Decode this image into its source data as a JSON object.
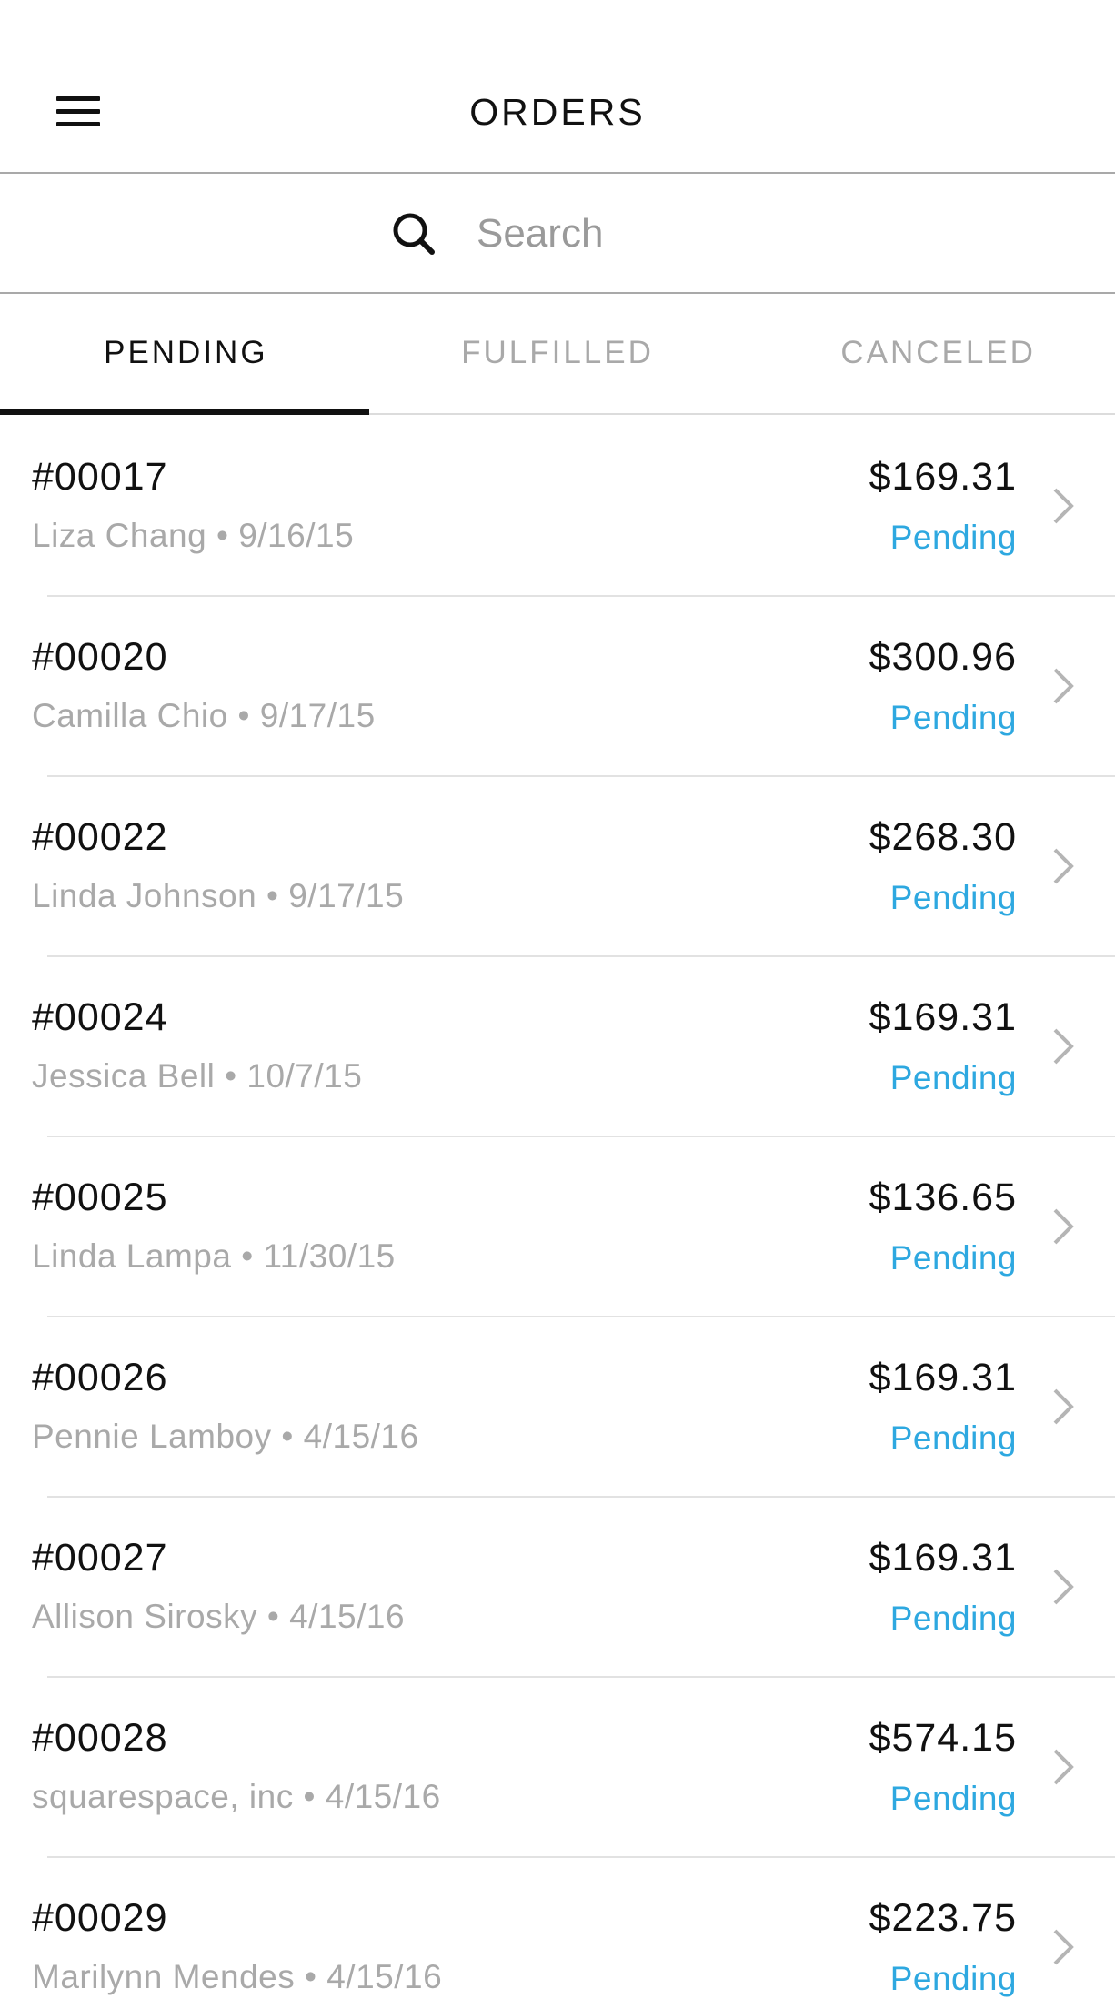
{
  "header": {
    "title": "ORDERS",
    "menu_icon": "hamburger-menu-icon"
  },
  "search": {
    "placeholder": "Search",
    "value": "",
    "icon": "search-icon"
  },
  "tabs": [
    {
      "label": "PENDING",
      "active": true
    },
    {
      "label": "FULFILLED",
      "active": false
    },
    {
      "label": "CANCELED",
      "active": false
    }
  ],
  "orders": [
    {
      "number": "#00017",
      "meta": "Liza Chang • 9/16/15",
      "amount": "$169.31",
      "status": "Pending"
    },
    {
      "number": "#00020",
      "meta": "Camilla Chio • 9/17/15",
      "amount": "$300.96",
      "status": "Pending"
    },
    {
      "number": "#00022",
      "meta": "Linda Johnson • 9/17/15",
      "amount": "$268.30",
      "status": "Pending"
    },
    {
      "number": "#00024",
      "meta": "Jessica Bell • 10/7/15",
      "amount": "$169.31",
      "status": "Pending"
    },
    {
      "number": "#00025",
      "meta": "Linda Lampa • 11/30/15",
      "amount": "$136.65",
      "status": "Pending"
    },
    {
      "number": "#00026",
      "meta": "Pennie Lamboy • 4/15/16",
      "amount": "$169.31",
      "status": "Pending"
    },
    {
      "number": "#00027",
      "meta": "Allison Sirosky • 4/15/16",
      "amount": "$169.31",
      "status": "Pending"
    },
    {
      "number": "#00028",
      "meta": "squarespace, inc • 4/15/16",
      "amount": "$574.15",
      "status": "Pending"
    },
    {
      "number": "#00029",
      "meta": "Marilynn Mendes • 4/15/16",
      "amount": "$223.75",
      "status": "Pending"
    }
  ],
  "colors": {
    "status_pending": "#2ea8e0",
    "text_primary": "#111111",
    "text_secondary": "#a9a9a9",
    "divider": "#e2e2e2"
  }
}
